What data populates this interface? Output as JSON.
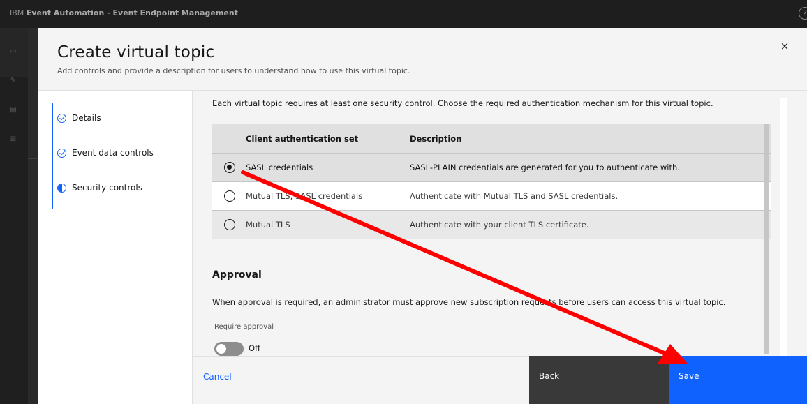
{
  "topbar": {
    "brand_prefix": "IBM",
    "brand_name": "Event Automation - Event Endpoint Management",
    "help_icon": "?"
  },
  "rail": {
    "icons": [
      "catalog-icon",
      "edit-icon",
      "document-icon",
      "topology-icon"
    ]
  },
  "modal": {
    "title": "Create virtual topic",
    "subtitle": "Add controls and provide a description for users to understand how to use this virtual topic.",
    "close_icon": "×"
  },
  "steps": [
    {
      "label": "Details",
      "status": "complete"
    },
    {
      "label": "Event data controls",
      "status": "complete"
    },
    {
      "label": "Security controls",
      "status": "current"
    }
  ],
  "security": {
    "intro": "Each virtual topic requires at least one security control. Choose the required authentication mechanism for this virtual topic.",
    "table": {
      "headers": [
        "Client authentication set",
        "Description"
      ],
      "rows": [
        {
          "name": "SASL credentials",
          "description": "SASL-PLAIN credentials are generated for you to authenticate with.",
          "selected": true
        },
        {
          "name": "Mutual TLS, SASL credentials",
          "description": "Authenticate with Mutual TLS and SASL credentials.",
          "selected": false
        },
        {
          "name": "Mutual TLS",
          "description": "Authenticate with your client TLS certificate.",
          "selected": false
        }
      ]
    }
  },
  "approval": {
    "heading": "Approval",
    "text": "When approval is required, an administrator must approve new subscription requests before users can access this virtual topic.",
    "toggle_label": "Require approval",
    "toggle_state": "Off"
  },
  "footer": {
    "cancel": "Cancel",
    "back": "Back",
    "save": "Save"
  },
  "colors": {
    "primary": "#0f62fe",
    "annotation_arrow": "#ff0000"
  }
}
